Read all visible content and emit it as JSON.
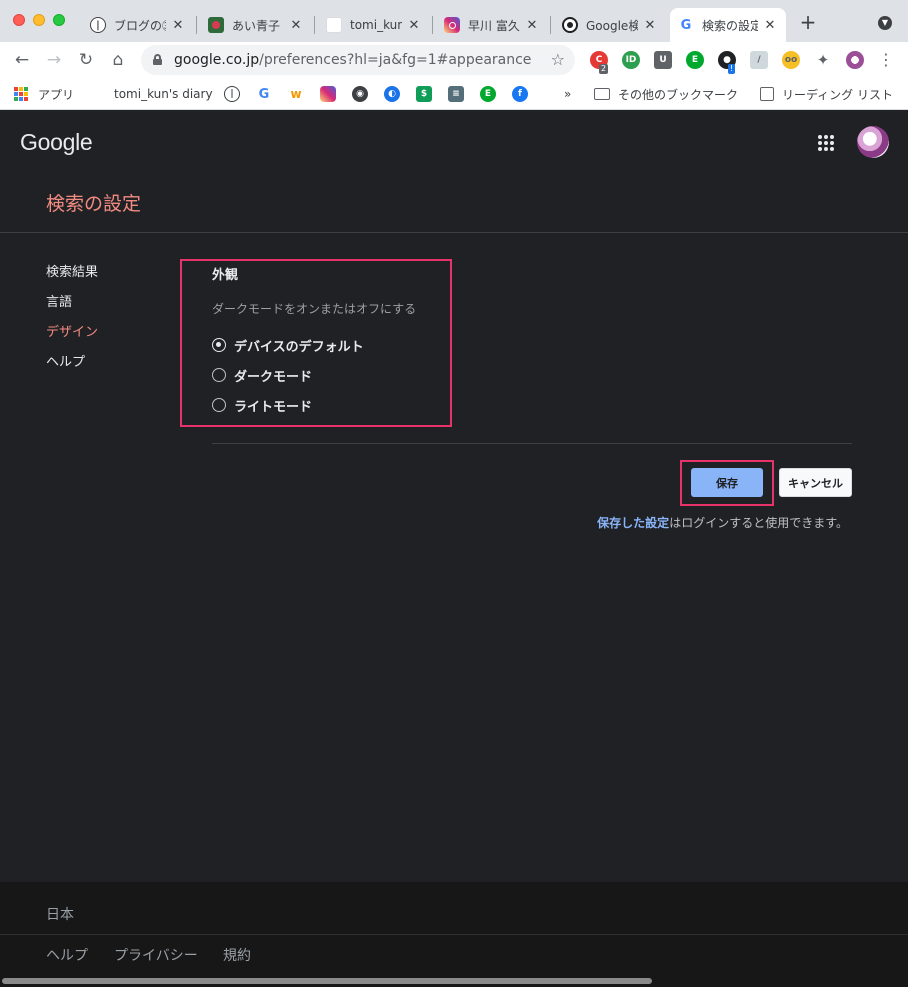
{
  "browser": {
    "tabs": [
      {
        "title": "ブログの㉝",
        "favicon": "blog-icon"
      },
      {
        "title": "あい青子",
        "favicon": "flower-icon"
      },
      {
        "title": "tomi_kun",
        "favicon": "blank-icon"
      },
      {
        "title": "早川 富久",
        "favicon": "instagram-icon"
      },
      {
        "title": "Google検",
        "favicon": "panda-icon"
      },
      {
        "title": "検索の設定",
        "favicon": "google-icon"
      }
    ],
    "close_glyph": "✕",
    "new_tab_glyph": "+",
    "url": {
      "host": "google.co.jp",
      "path": "/preferences?hl=ja&fg=1#appearance"
    },
    "extension_badges": {
      "ext1": "2",
      "ext2": "!"
    },
    "bookmarks": {
      "apps": "アプリ",
      "diary": "tomi_kun's diary",
      "overflow": "»",
      "other": "その他のブックマーク",
      "reading_list": "リーディング リスト"
    },
    "colors": {
      "accent": "#1a73e8"
    }
  },
  "page": {
    "logo": "Google",
    "title": "検索の設定",
    "sidenav": [
      "検索結果",
      "言語",
      "デザイン",
      "ヘルプ"
    ],
    "appearance": {
      "heading": "外観",
      "description": "ダークモードをオンまたはオフにする",
      "options": [
        "デバイスのデフォルト",
        "ダークモード",
        "ライトモード"
      ],
      "selected_index": 0
    },
    "buttons": {
      "save": "保存",
      "cancel": "キャンセル"
    },
    "save_note": {
      "link": "保存した設定",
      "text": "はログインすると使用できます。"
    },
    "colors": {
      "title": "#f28b82",
      "link": "#8ab4f8",
      "highlight": "#e8326a",
      "background": "#202124"
    }
  },
  "footer": {
    "country": "日本",
    "links": [
      "ヘルプ",
      "プライバシー",
      "規約"
    ]
  }
}
